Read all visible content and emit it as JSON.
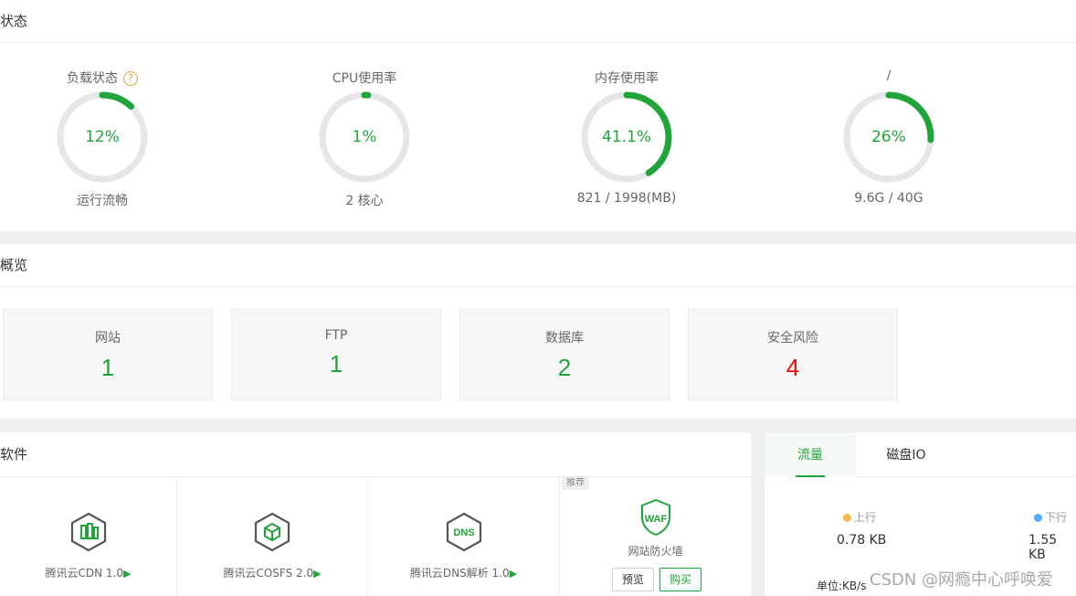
{
  "status": {
    "title": "状态",
    "gauges": [
      {
        "title": "负载状态",
        "help": "?",
        "value": "12%",
        "percent": 12,
        "sub": "运行流畅"
      },
      {
        "title": "CPU使用率",
        "value": "1%",
        "percent": 1,
        "sub": "2 核心"
      },
      {
        "title": "内存使用率",
        "value": "41.1%",
        "percent": 41.1,
        "sub": "821 / 1998(MB)"
      },
      {
        "title": "/",
        "value": "26%",
        "percent": 26,
        "sub": "9.6G / 40G"
      }
    ],
    "colors": {
      "accent": "#20a53a",
      "track": "#e6e6e6"
    }
  },
  "overview": {
    "title": "概览",
    "cards": [
      {
        "label": "网站",
        "value": "1"
      },
      {
        "label": "FTP",
        "value": "1"
      },
      {
        "label": "数据库",
        "value": "2"
      },
      {
        "label": "安全风险",
        "value": "4"
      }
    ]
  },
  "software": {
    "title": "软件",
    "items": [
      {
        "name": "腾讯云CDN 1.0",
        "play": "▶",
        "icon": "cdn-icon"
      },
      {
        "name": "腾讯云COSFS 2.0",
        "play": "▶",
        "icon": "cosfs-icon"
      },
      {
        "name": "腾讯云DNS解析 1.0",
        "play": "▶",
        "icon": "dns-icon",
        "icon_text": "DNS"
      }
    ],
    "waf": {
      "tag": "推荐",
      "icon_text": "WAF",
      "name": "网站防火墙",
      "preview": "预览",
      "buy": "购买"
    }
  },
  "traffic": {
    "tabs": [
      "流量",
      "磁盘IO"
    ],
    "up": {
      "label": "上行",
      "value": "0.78 KB",
      "color": "#f7b851"
    },
    "down": {
      "label": "下行",
      "value": "1.55 KB",
      "color": "#52a9ff"
    },
    "unit": "单位:KB/s"
  },
  "watermark": "CSDN @网瘾中心呼唤爱"
}
